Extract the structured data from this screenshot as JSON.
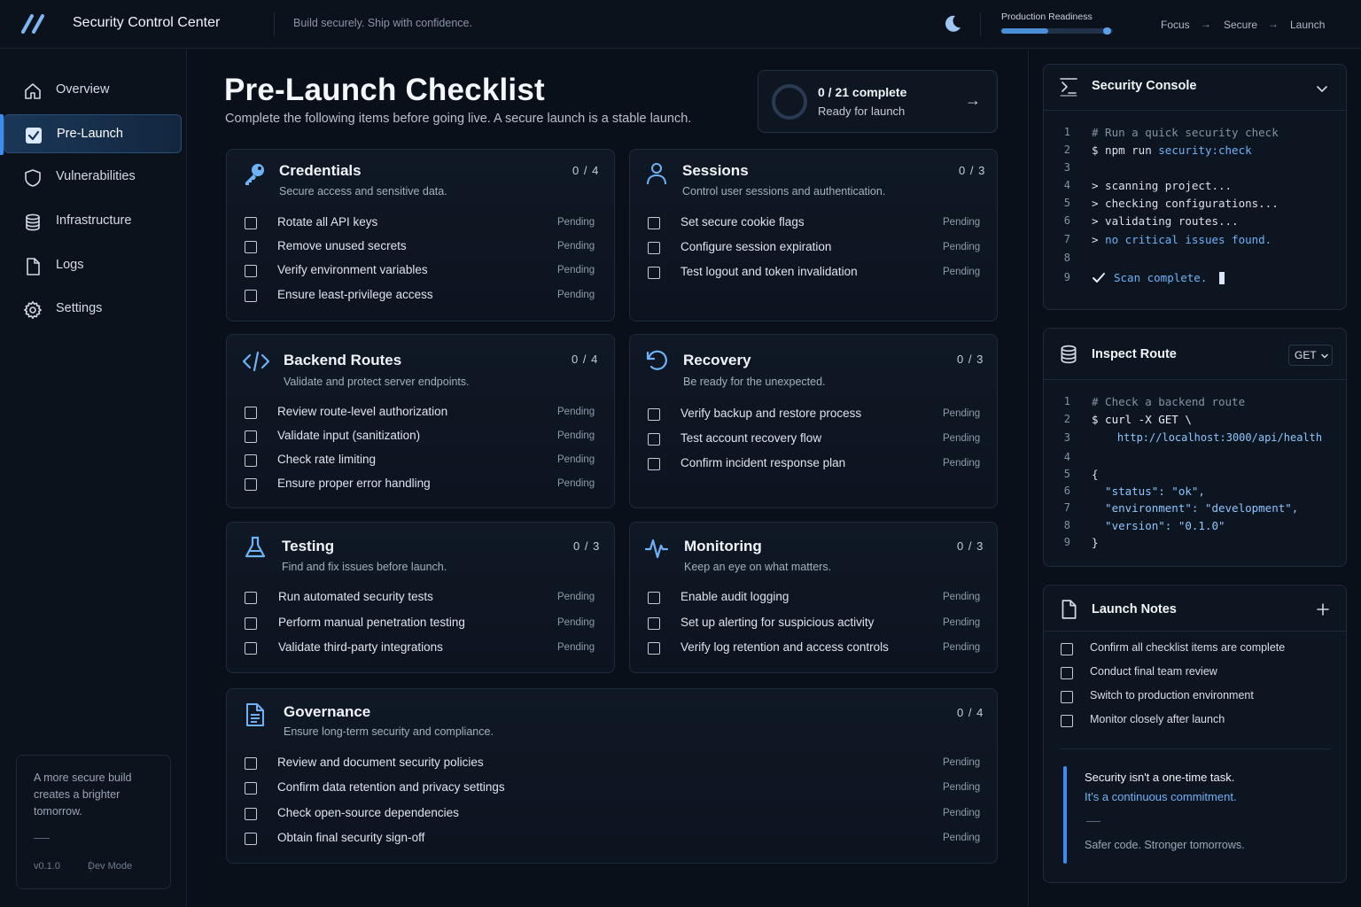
{
  "topbar": {
    "title": "Security Control Center",
    "tagline": "Build securely. Ship with confidence.",
    "readiness_label": "Production Readiness",
    "readiness_progress": 0.42,
    "flow": [
      "Focus",
      "Secure",
      "Launch"
    ],
    "flow_arrow": "→"
  },
  "sidebar": {
    "items": [
      {
        "label": "Overview",
        "icon": "home-icon"
      },
      {
        "label": "Pre-Launch",
        "icon": "checkbox-icon",
        "active": true
      },
      {
        "label": "Vulnerabilities",
        "icon": "shield-icon"
      },
      {
        "label": "Infrastructure",
        "icon": "database-icon"
      },
      {
        "label": "Logs",
        "icon": "file-icon"
      },
      {
        "label": "Settings",
        "icon": "gear-icon"
      }
    ],
    "quote": "A more secure build creates a brighter tomorrow.",
    "version": "v0.1.0",
    "mode": "Dev Mode"
  },
  "main": {
    "title": "Pre-Launch Checklist",
    "subtitle": "Complete the following items before going live. A secure launch is a stable launch.",
    "summary": {
      "count": "0 / 21 complete",
      "status": "Ready for launch"
    },
    "cards": {
      "credentials": {
        "title": "Credentials",
        "desc": "Secure access and sensitive data.",
        "count": "0 / 4",
        "items": [
          {
            "label": "Rotate all API keys",
            "status": "Pending"
          },
          {
            "label": "Remove unused secrets",
            "status": "Pending"
          },
          {
            "label": "Verify environment variables",
            "status": "Pending"
          },
          {
            "label": "Ensure least-privilege access",
            "status": "Pending"
          }
        ]
      },
      "sessions": {
        "title": "Sessions",
        "desc": "Control user sessions and authentication.",
        "count": "0 / 3",
        "items": [
          {
            "label": "Set secure cookie flags",
            "status": "Pending"
          },
          {
            "label": "Configure session expiration",
            "status": "Pending"
          },
          {
            "label": "Test logout and token invalidation",
            "status": "Pending"
          }
        ]
      },
      "backend": {
        "title": "Backend Routes",
        "desc": "Validate and protect server endpoints.",
        "count": "0 / 4",
        "items": [
          {
            "label": "Review route-level authorization",
            "status": "Pending"
          },
          {
            "label": "Validate input (sanitization)",
            "status": "Pending"
          },
          {
            "label": "Check rate limiting",
            "status": "Pending"
          },
          {
            "label": "Ensure proper error handling",
            "status": "Pending"
          }
        ]
      },
      "recovery": {
        "title": "Recovery",
        "desc": "Be ready for the unexpected.",
        "count": "0 / 3",
        "items": [
          {
            "label": "Verify backup and restore process",
            "status": "Pending"
          },
          {
            "label": "Test account recovery flow",
            "status": "Pending"
          },
          {
            "label": "Confirm incident response plan",
            "status": "Pending"
          }
        ]
      },
      "testing": {
        "title": "Testing",
        "desc": "Find and fix issues before launch.",
        "count": "0 / 3",
        "items": [
          {
            "label": "Run automated security tests",
            "status": "Pending"
          },
          {
            "label": "Perform manual penetration testing",
            "status": "Pending"
          },
          {
            "label": "Validate third-party integrations",
            "status": "Pending"
          }
        ]
      },
      "monitoring": {
        "title": "Monitoring",
        "desc": "Keep an eye on what matters.",
        "count": "0 / 3",
        "items": [
          {
            "label": "Enable audit logging",
            "status": "Pending"
          },
          {
            "label": "Set up alerting for suspicious activity",
            "status": "Pending"
          },
          {
            "label": "Verify log retention and access controls",
            "status": "Pending"
          }
        ]
      },
      "governance": {
        "title": "Governance",
        "desc": "Ensure long-term security and compliance.",
        "count": "0 / 4",
        "items": [
          {
            "label": "Review and document security policies",
            "status": "Pending"
          },
          {
            "label": "Confirm data retention and privacy settings",
            "status": "Pending"
          },
          {
            "label": "Check open-source dependencies",
            "status": "Pending"
          },
          {
            "label": "Obtain final security sign-off",
            "status": "Pending"
          }
        ]
      }
    }
  },
  "console": {
    "title": "Security Console",
    "lines": [
      {
        "n": "1",
        "text": "# Run a quick security check"
      },
      {
        "n": "2",
        "text": "$ npm run security:check"
      },
      {
        "n": "3",
        "text": ""
      },
      {
        "n": "4",
        "text": "> scanning project..."
      },
      {
        "n": "5",
        "text": "> checking configurations..."
      },
      {
        "n": "6",
        "text": "> validating routes..."
      },
      {
        "n": "7",
        "text": "> no critical issues found."
      },
      {
        "n": "8",
        "text": ""
      },
      {
        "n": "9",
        "text": "Scan complete."
      }
    ]
  },
  "inspect": {
    "title": "Inspect Route",
    "method": "GET",
    "lines": [
      {
        "n": "1",
        "text": "# Check a backend route"
      },
      {
        "n": "2",
        "text": "$ curl -X GET \\"
      },
      {
        "n": "3",
        "text": "    http://localhost:3000/api/health"
      },
      {
        "n": "4",
        "text": ""
      },
      {
        "n": "5",
        "text": "{"
      },
      {
        "n": "6",
        "text": "  \"status\": \"ok\","
      },
      {
        "n": "7",
        "text": "  \"environment\": \"development\","
      },
      {
        "n": "8",
        "text": "  \"version\": \"0.1.0\""
      },
      {
        "n": "9",
        "text": "}"
      }
    ]
  },
  "notes": {
    "title": "Launch Notes",
    "items": [
      "Confirm all checklist items are complete",
      "Conduct final team review",
      "Switch to production environment",
      "Monitor closely after launch"
    ],
    "callout_line1": "Security isn't a one-time task.",
    "callout_line2": "It's a continuous commitment.",
    "callout_footer": "Safer code. Stronger tomorrows."
  },
  "colors": {
    "accent": "#3d8df0",
    "background": "#0a1019",
    "card": "#0f1824"
  }
}
